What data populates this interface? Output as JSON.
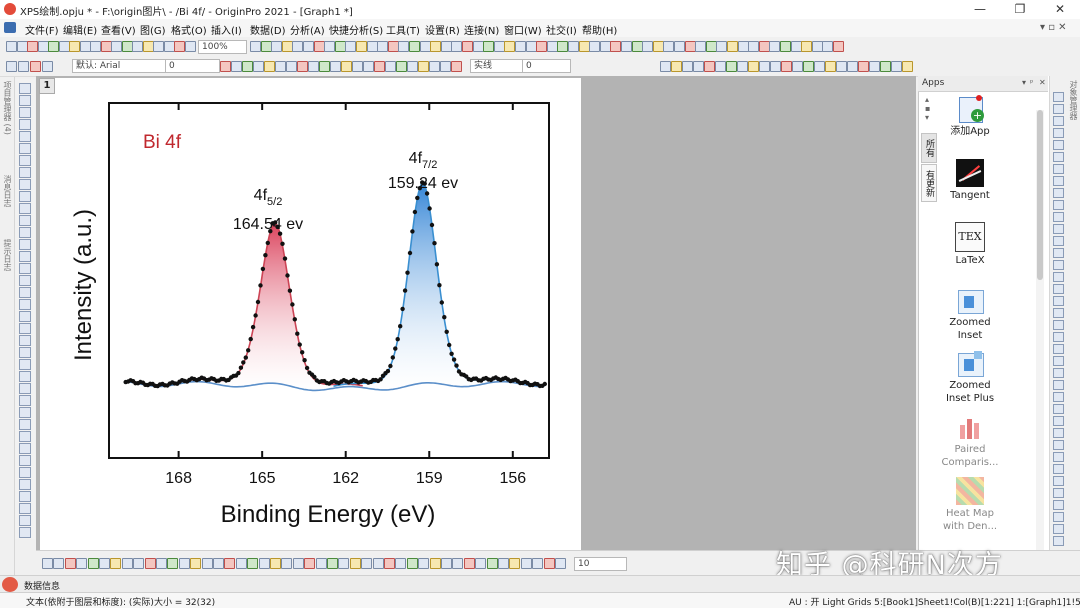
{
  "window": {
    "title": "XPS绘制.opju * - F:\\origin图片\\ - /Bi 4f/ - OriginPro 2021 - [Graph1 *]",
    "minimize": "—",
    "maximize": "❐",
    "close": "✕",
    "sub_controls": "▾ ▫ ✕"
  },
  "menu": [
    "文件(F)",
    "编辑(E)",
    "查看(V)",
    "图(G)",
    "格式(O)",
    "插入(I)",
    "数据(D)",
    "分析(A)",
    "快捷分析(S)",
    "工具(T)",
    "设置(R)",
    "连接(N)",
    "窗口(W)",
    "社交(I)",
    "帮助(H)"
  ],
  "toolbar": {
    "zoom": "100%",
    "font": "默认: Arial",
    "font_size": "0",
    "line_style": "实线",
    "line_width": "0",
    "bottom_value": "10"
  },
  "left_dock": {
    "tab1": "项目管理器 (4)",
    "tab2": "消息日志",
    "tab3": "提示日志"
  },
  "page": {
    "number": "1"
  },
  "chart_data": {
    "type": "line",
    "title": "",
    "annotation": "Bi 4f",
    "xlabel": "Binding Energy (eV)",
    "ylabel": "Intensity (a.u.)",
    "xlim": [
      170.5,
      154.7
    ],
    "ylim": [
      0,
      1
    ],
    "x_reversed": true,
    "xticks": [
      168,
      165,
      162,
      159,
      156
    ],
    "yticks": [],
    "peaks": [
      {
        "label_main": "4f",
        "label_sub": "5/2",
        "energy_text": "164.54 ev",
        "center": 164.54,
        "height": 0.8,
        "fwhm": 1.25,
        "fill_color": "#d93a55"
      },
      {
        "label_main": "4f",
        "label_sub": "7/2",
        "energy_text": "159.24 ev",
        "center": 159.24,
        "height": 1.0,
        "fwhm": 1.2,
        "fill_color": "#2a7fd4"
      }
    ],
    "baseline": 0.1,
    "colors": {
      "raw_points": "#111111",
      "fit_line": "#cc4455",
      "envelope": "#3a8fd0",
      "background_line": "#5b8fc9",
      "annotation": "#c0282e"
    }
  },
  "apps": {
    "title": "Apps",
    "tab_all": "所有",
    "tab_updates": "有更新",
    "items": [
      {
        "label": "添加App",
        "icon": "add-app-icon",
        "dim": false
      },
      {
        "label": "Tangent",
        "icon": "tangent-icon",
        "dim": false
      },
      {
        "label": "LaTeX",
        "icon": "latex-icon",
        "dim": false
      },
      {
        "label": "Zoomed Inset",
        "icon": "zoomed-inset-icon",
        "dim": false
      },
      {
        "label": "Zoomed Inset Plus",
        "icon": "zoomed-inset-plus-icon",
        "dim": false
      },
      {
        "label": "Paired Comparis...",
        "icon": "paired-comparison-icon",
        "dim": true
      },
      {
        "label": "Heat Map with Den...",
        "icon": "heat-map-icon",
        "dim": true
      }
    ]
  },
  "messages_tab": "数据信息",
  "status": {
    "left": "文本(依附于图层和标度): (实际)大小 = 32(32)",
    "right": "AU : 开 Light Grids 5:[Book1]Sheet1!Col(B)[1:221] 1:[Graph1]1!5 弧度"
  },
  "watermark": "知乎 @科研N次方"
}
